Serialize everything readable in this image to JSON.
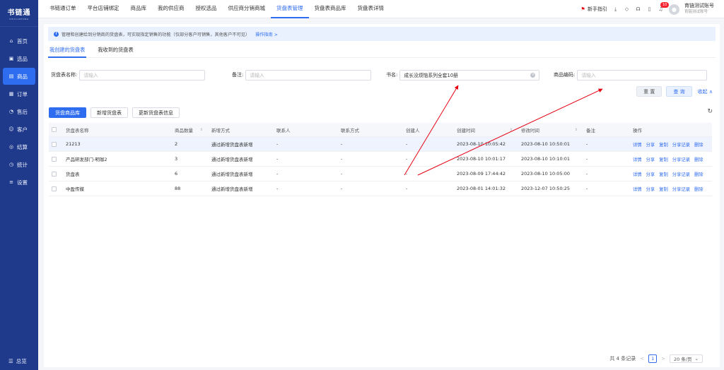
{
  "sidebar": {
    "logo_main": "书链通",
    "logo_sub": "SHULIANTONG",
    "items": [
      {
        "label": "首页",
        "icon": "home-icon",
        "glyph": "⌂"
      },
      {
        "label": "选品",
        "icon": "select-icon",
        "glyph": "▣"
      },
      {
        "label": "商品",
        "icon": "goods-icon",
        "glyph": "▤"
      },
      {
        "label": "订单",
        "icon": "order-icon",
        "glyph": "▦"
      },
      {
        "label": "售后",
        "icon": "aftersale-icon",
        "glyph": "◔"
      },
      {
        "label": "客户",
        "icon": "customer-icon",
        "glyph": "☺"
      },
      {
        "label": "结算",
        "icon": "settle-icon",
        "glyph": "◎"
      },
      {
        "label": "统计",
        "icon": "stats-icon",
        "glyph": "◷"
      },
      {
        "label": "设置",
        "icon": "settings-icon",
        "glyph": "≡"
      }
    ],
    "active_index": 2,
    "bottom_label": "总览"
  },
  "topbar": {
    "tabs": [
      "书链通订单",
      "平台店铺绑定",
      "商品库",
      "我的供应商",
      "授权选品",
      "供应商分销商城",
      "货盘表管理",
      "货盘表商品库",
      "货盘表详情"
    ],
    "active_tab": 6,
    "guide_label": "新手指引",
    "notification_count": "10",
    "user_name": "育链测试账号",
    "user_sub": "育链测试账号"
  },
  "notice": {
    "text": "管理和创建给到分销商的货盘表，可实现指定销售的功能（仅部分客户可销售，其他客户不可见）",
    "link": "操作指南 >"
  },
  "subtabs": [
    "我创建的货盘表",
    "我收到的货盘表"
  ],
  "filters": {
    "name_label": "货盘表名称:",
    "name_placeholder": "请输入",
    "remark_label": "备注:",
    "remark_placeholder": "请输入",
    "book_label": "书名:",
    "book_value": "成长没烦恼系列全套10册",
    "code_label": "商品编码:",
    "code_placeholder": "请输入"
  },
  "buttons": {
    "reset": "重 置",
    "query": "查 询",
    "collapse": "收起 ∧"
  },
  "actions": [
    "货盘商品库",
    "新增货盘表",
    "更新货盘表信息"
  ],
  "table": {
    "headers": [
      "货盘表名称",
      "商品数量",
      "新增方式",
      "联系人",
      "联系方式",
      "创建人",
      "创建时间",
      "修改时间",
      "备注",
      "操作"
    ],
    "rows": [
      [
        "21213",
        "2",
        "通过新增货盘表新增",
        "-",
        "-",
        "-",
        "2023-08-10 10:05:42",
        "2023-08-10 10:50:01",
        "-"
      ],
      [
        "产品研发部门-明珈2",
        "3",
        "通过新增货盘表新增",
        "-",
        "-",
        "-",
        "2023-08-10 10:01:17",
        "2023-08-10 10:10:01",
        "-"
      ],
      [
        "货盘表",
        "6",
        "通过新增货盘表新增",
        "-",
        "-",
        "-",
        "2023-08-09 17:44:42",
        "2023-08-10 10:05:00",
        "-"
      ],
      [
        "中盈传媒",
        "88",
        "通过新增货盘表新增",
        "-",
        "-",
        "-",
        "2023-08-01 14:01:32",
        "2023-12-07 10:50:25",
        "-"
      ]
    ],
    "ops": [
      "详情",
      "分享",
      "复制",
      "分享记录",
      "删除"
    ]
  },
  "pager": {
    "total": "共 4 条记录",
    "prev": "<",
    "page": "1",
    "next": ">",
    "size": "20 条/页"
  },
  "annotation_color": "#e60012"
}
